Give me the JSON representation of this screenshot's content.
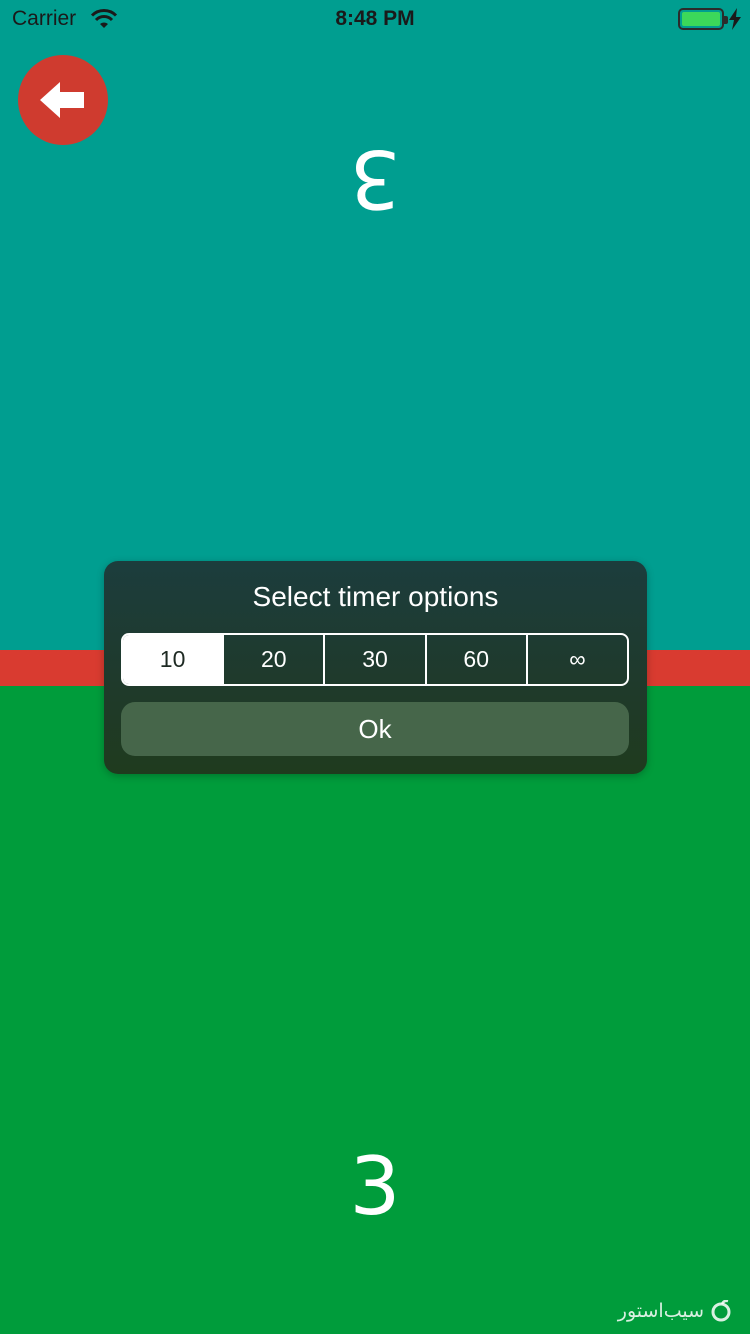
{
  "status_bar": {
    "carrier": "Carrier",
    "time": "8:48 PM",
    "battery_color": "#3cd85a"
  },
  "back_button": {
    "icon": "arrow-left-icon",
    "color": "#cf3b2f"
  },
  "players": {
    "top_score": "3",
    "bottom_score": "3",
    "top_color": "#009e90",
    "bottom_color": "#009c3b",
    "divider_color": "#d93b30"
  },
  "dialog": {
    "title": "Select timer options",
    "options": [
      "10",
      "20",
      "30",
      "60",
      "∞"
    ],
    "selected_option": "10",
    "ok_label": "Ok"
  },
  "watermark": {
    "text": "سیب‌استور"
  }
}
